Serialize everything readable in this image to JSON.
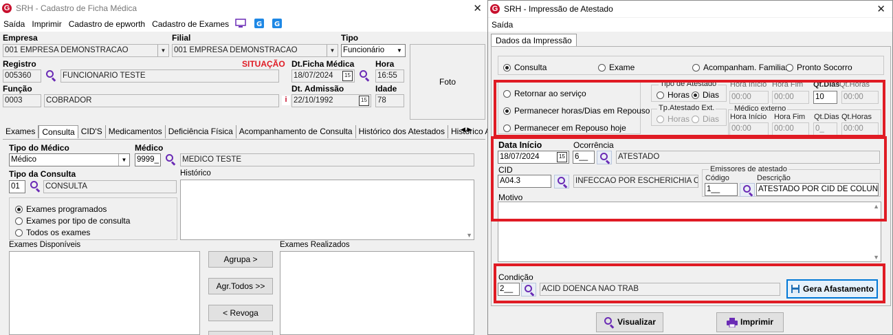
{
  "left": {
    "title": "SRH - Cadastro de Ficha Médica",
    "menu": [
      "Saída",
      "Imprimir",
      "Cadastro de epworth",
      "Cadastro de Exames"
    ],
    "labels": {
      "empresa": "Empresa",
      "filial": "Filial",
      "tipo": "Tipo",
      "registro": "Registro",
      "situacao": "SITUAÇÃO",
      "dt_ficha": "Dt.Ficha Médica",
      "hora": "Hora",
      "funcao": "Função",
      "dt_admissao": "Dt. Admissão",
      "idade": "Idade",
      "foto": "Foto",
      "tipo_medico": "Tipo do Médico",
      "medico": "Médico",
      "tipo_consulta": "Tipo da Consulta",
      "historico": "Histórico",
      "exames_disponiveis": "Exames Disponíveis",
      "exames_realizados": "Exames Realizados"
    },
    "values": {
      "empresa": "001 EMPRESA DEMONSTRACAO",
      "filial": "001 EMPRESA DEMONSTRACAO",
      "tipo": "Funcionário",
      "registro": "005360",
      "funcionario": "FUNCIONARIO TESTE",
      "dt_ficha": "18/07/2024",
      "hora": "16:55",
      "funcao_cod": "0003",
      "funcao_desc": "COBRADOR",
      "dt_admissao": "22/10/1992",
      "idade": "78",
      "tipo_medico": "Médico",
      "medico_cod": "9999_",
      "medico_nome": "MEDICO TESTE",
      "consulta_cod": "01",
      "consulta_desc": "CONSULTA"
    },
    "tabs": [
      "Exames",
      "Consulta",
      "CID'S",
      "Medicamentos",
      "Deficiência Física",
      "Acompanhamento de Consulta",
      "Histórico dos Atestados",
      "Histórico A.S"
    ],
    "exam_radios": [
      "Exames programados",
      "Exames por tipo de consulta",
      "Todos os exames"
    ],
    "buttons": {
      "agrupa": "Agrupa >",
      "agr_todos": "Agr.Todos >>",
      "revoga": "< Revoga"
    }
  },
  "right": {
    "title": "SRH - Impressão de Atestado",
    "menu": "Saída",
    "tab": "Dados da Impressão",
    "top_radios": [
      "Consulta",
      "Exame",
      "Acompanham. Familiar",
      "Pronto Socorro"
    ],
    "retorno_radios": [
      "Retornar ao serviço",
      "Permanecer  horas/Dias em Repouso",
      "Permanecer em Repouso hoje"
    ],
    "tipo_atestado": {
      "title": "Tipo de Atestado",
      "horas": "Horas",
      "dias": "Dias"
    },
    "tp_atestado_ext": {
      "title": "Tp.Atestado Ext.",
      "horas": "Horas",
      "dias": "Dias"
    },
    "medico_externo": "Médico externo",
    "cols": {
      "hora_inicio": "Hora Início",
      "hora_fim": "Hora Fim",
      "qt_dias": "Qt.Dias",
      "qt_horas": "Qt.Horas"
    },
    "vals": {
      "hi1": "00:00",
      "hf1": "00:00",
      "qd1": "10",
      "qh1": "00:00",
      "hi2": "00:00",
      "hf2": "00:00",
      "qd2": "0_",
      "qh2": "00:00"
    },
    "form": {
      "data_inicio_lbl": "Data Início",
      "data_inicio": "18/07/2024",
      "ocorrencia_lbl": "Ocorrência",
      "ocorrencia_cod": "6__",
      "ocorrencia_desc": "ATESTADO",
      "cid_lbl": "CID",
      "cid": "A04.3",
      "cid_desc": "INFECCAO POR ESCHERICHIA COL",
      "emissores_lbl": "Emissores de atestado",
      "codigo_lbl": "Código",
      "codigo": "1__",
      "descricao_lbl": "Descrição",
      "descricao": "ATESTADO POR CID DE COLUNA",
      "motivo_lbl": "Motivo",
      "condicao_lbl": "Condição",
      "condicao_cod": "2__",
      "condicao_desc": "ACID DOENCA NAO TRAB"
    },
    "buttons": {
      "gera": "Gera Afastamento",
      "visualizar": "Visualizar",
      "imprimir": "Imprimir"
    }
  }
}
